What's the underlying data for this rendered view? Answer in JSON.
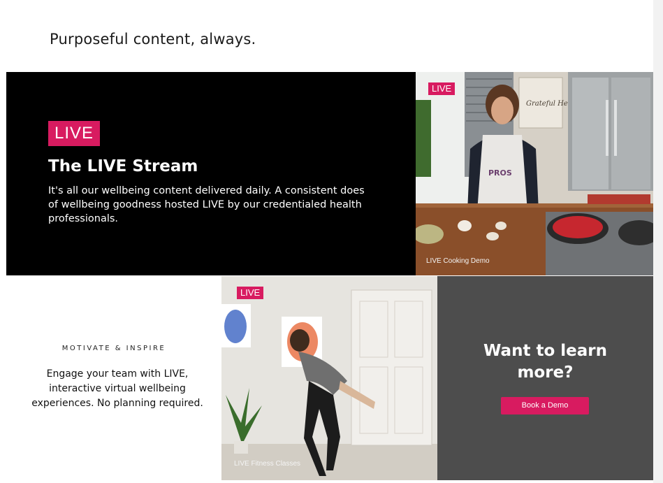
{
  "headline": "Purposeful content, always.",
  "hero": {
    "badge": "LIVE",
    "title": "The LIVE Stream",
    "description": "It's all our wellbeing content delivered daily. A consistent does of wellbeing goodness hosted LIVE by our credentialed health professionals."
  },
  "cooking": {
    "badge": "LIVE",
    "caption": "LIVE Cooking Demo",
    "art_text": "Grateful Heart",
    "apron_text": "PROS"
  },
  "motivate": {
    "overline": "MOTIVATE & INSPIRE",
    "description": "Engage your team with LIVE, interactive virtual wellbeing experiences. No planning required."
  },
  "fitness": {
    "badge": "LIVE",
    "caption": "LIVE Fitness Classes"
  },
  "cta": {
    "title_line1": "Want to learn",
    "title_line2": "more?",
    "button_label": "Book a Demo"
  },
  "colors": {
    "accent": "#d81b60",
    "hero_bg": "#000000",
    "cta_bg": "#4d4d4d"
  }
}
